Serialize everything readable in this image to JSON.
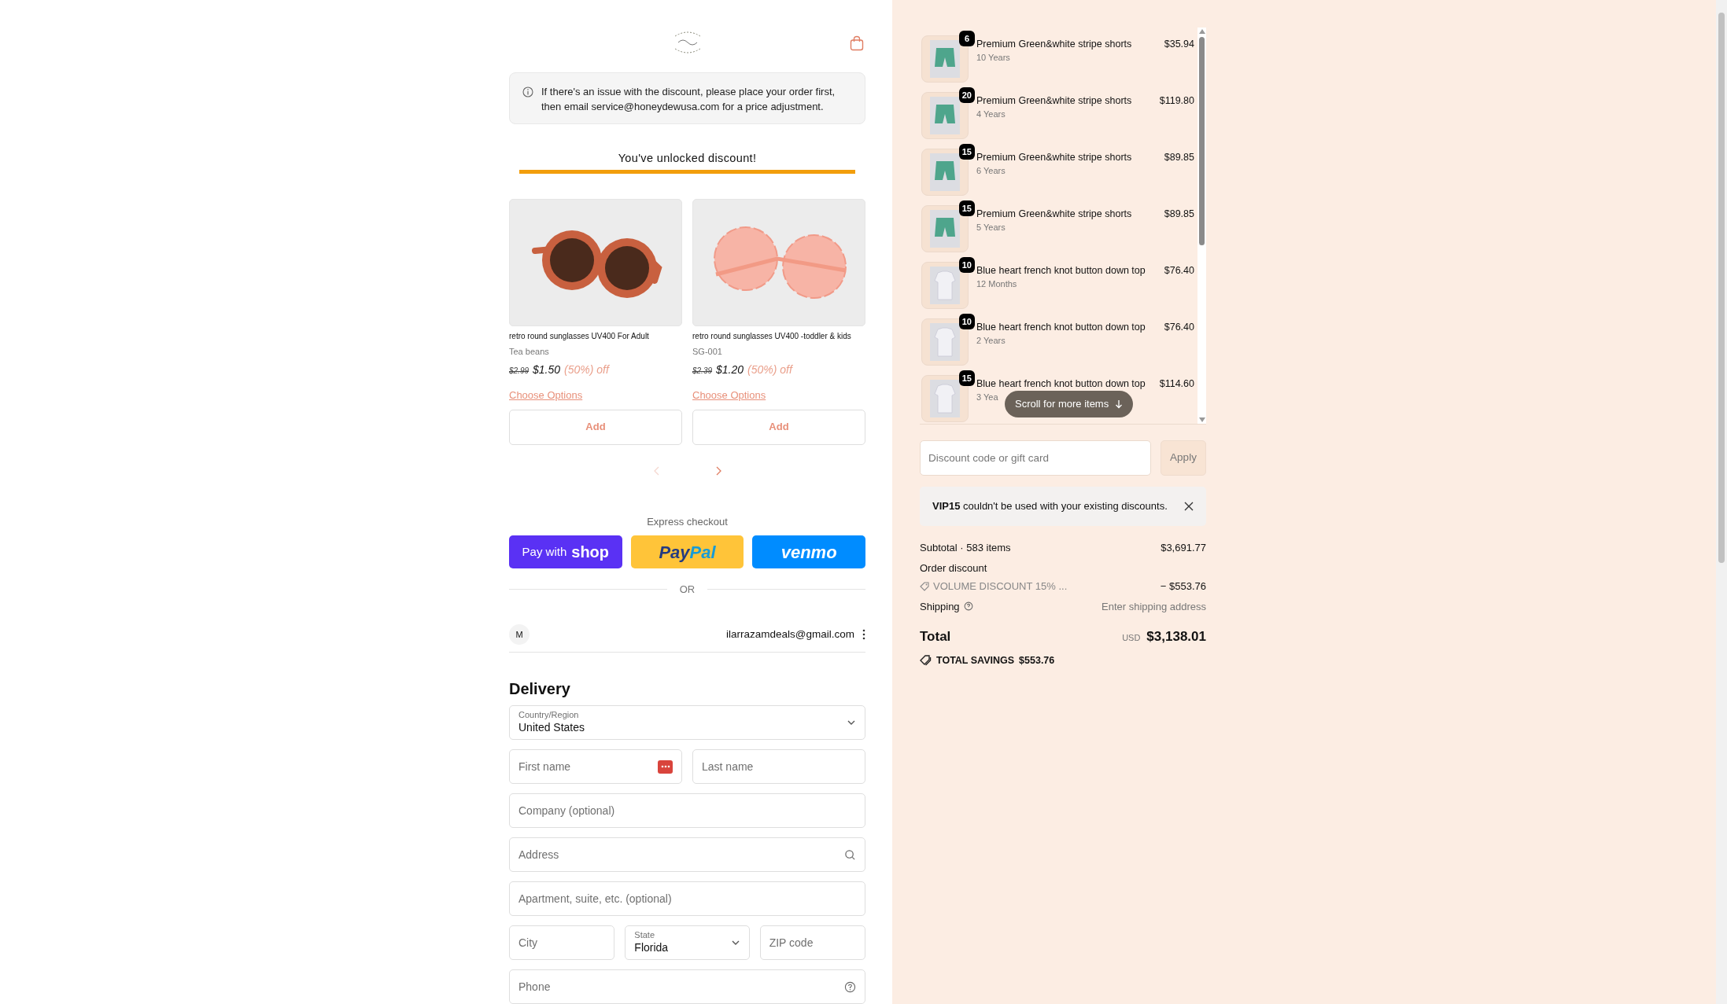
{
  "notice": {
    "text": "If there's an issue with the discount, please place your order first, then email service@honeydewusa.com for a price adjustment."
  },
  "progress": {
    "message": "You've unlocked discount!",
    "level": 1
  },
  "upsell": {
    "products": [
      {
        "kind": "round",
        "title": "retro round sunglasses UV400 For Adult",
        "variant": "Tea beans",
        "compare_price": "$2.99",
        "price": "$1.50",
        "discount": "(50%) off",
        "options_link": "Choose Options",
        "add_button": "Add"
      },
      {
        "kind": "flower",
        "title": "retro round sunglasses UV400 -toddler & kids",
        "variant": "SG-001",
        "compare_price": "$2.39",
        "price": "$1.20",
        "discount": "(50%) off",
        "options_link": "Choose Options",
        "add_button": "Add"
      }
    ],
    "prev_disabled": true,
    "next_disabled": false
  },
  "express": {
    "title": "Express checkout",
    "buttons": [
      {
        "kind": "shop",
        "label": "Pay with",
        "brand": [
          "shop"
        ]
      },
      {
        "kind": "paypal",
        "brand": [
          "Pay",
          "Pal"
        ]
      },
      {
        "kind": "venmo",
        "brand": [
          "venmo"
        ]
      }
    ],
    "divider": "OR"
  },
  "account": {
    "initial": "M",
    "email": "ilarrazamdeals@gmail.com"
  },
  "delivery": {
    "title": "Delivery",
    "rows": [
      [
        {
          "kind": "select",
          "label": "Country/Region",
          "value": "United States"
        }
      ],
      [
        {
          "kind": "autofill",
          "placeholder": "First name"
        },
        {
          "kind": "text",
          "placeholder": "Last name"
        }
      ],
      [
        {
          "kind": "text",
          "placeholder": "Company (optional)"
        }
      ],
      [
        {
          "kind": "search",
          "placeholder": "Address"
        }
      ],
      [
        {
          "kind": "text",
          "placeholder": "Apartment, suite, etc. (optional)"
        }
      ],
      [
        {
          "kind": "text",
          "placeholder": "City"
        },
        {
          "kind": "select",
          "label": "State",
          "value": "Florida"
        },
        {
          "kind": "text",
          "placeholder": "ZIP code"
        }
      ],
      [
        {
          "kind": "help",
          "placeholder": "Phone"
        }
      ]
    ]
  },
  "order": {
    "items": [
      {
        "kind": "shorts",
        "quantity": "6",
        "name": "Premium Green&white stripe shorts",
        "variant": "10 Years",
        "price": "$35.94"
      },
      {
        "kind": "shorts",
        "quantity": "20",
        "name": "Premium Green&white stripe shorts",
        "variant": "4 Years",
        "price": "$119.80"
      },
      {
        "kind": "shorts",
        "quantity": "15",
        "name": "Premium Green&white stripe shorts",
        "variant": "6 Years",
        "price": "$89.85"
      },
      {
        "kind": "shorts",
        "quantity": "15",
        "name": "Premium Green&white stripe shorts",
        "variant": "5 Years",
        "price": "$89.85"
      },
      {
        "kind": "top",
        "quantity": "10",
        "name": "Blue heart french knot button down top",
        "variant": "12 Months",
        "price": "$76.40"
      },
      {
        "kind": "top",
        "quantity": "10",
        "name": "Blue heart french knot button down top",
        "variant": "2 Years",
        "price": "$76.40"
      },
      {
        "kind": "top",
        "quantity": "15",
        "name": "Blue heart french knot button down top",
        "variant": "3 Yea",
        "price": "$114.60"
      }
    ],
    "scroll_hint": "Scroll for more items"
  },
  "discount": {
    "placeholder": "Discount code or gift card",
    "apply_button": "Apply",
    "apply_disabled": true
  },
  "error": {
    "text": "**VIP15** couldn't be used with your existing discounts."
  },
  "summary": {
    "subtotal_label": "Subtotal · 583 items",
    "subtotal": "$3,691.77",
    "order_discount_label": "Order discount",
    "discount_code": "VOLUME DISCOUNT 15% ...",
    "discount_amount": "− $553.76",
    "shipping_label": "Shipping",
    "shipping_value": "Enter shipping address",
    "total_label": "Total",
    "currency": "USD",
    "total": "$3,138.01",
    "savings_label": "TOTAL SAVINGS",
    "savings": "$553.76"
  }
}
